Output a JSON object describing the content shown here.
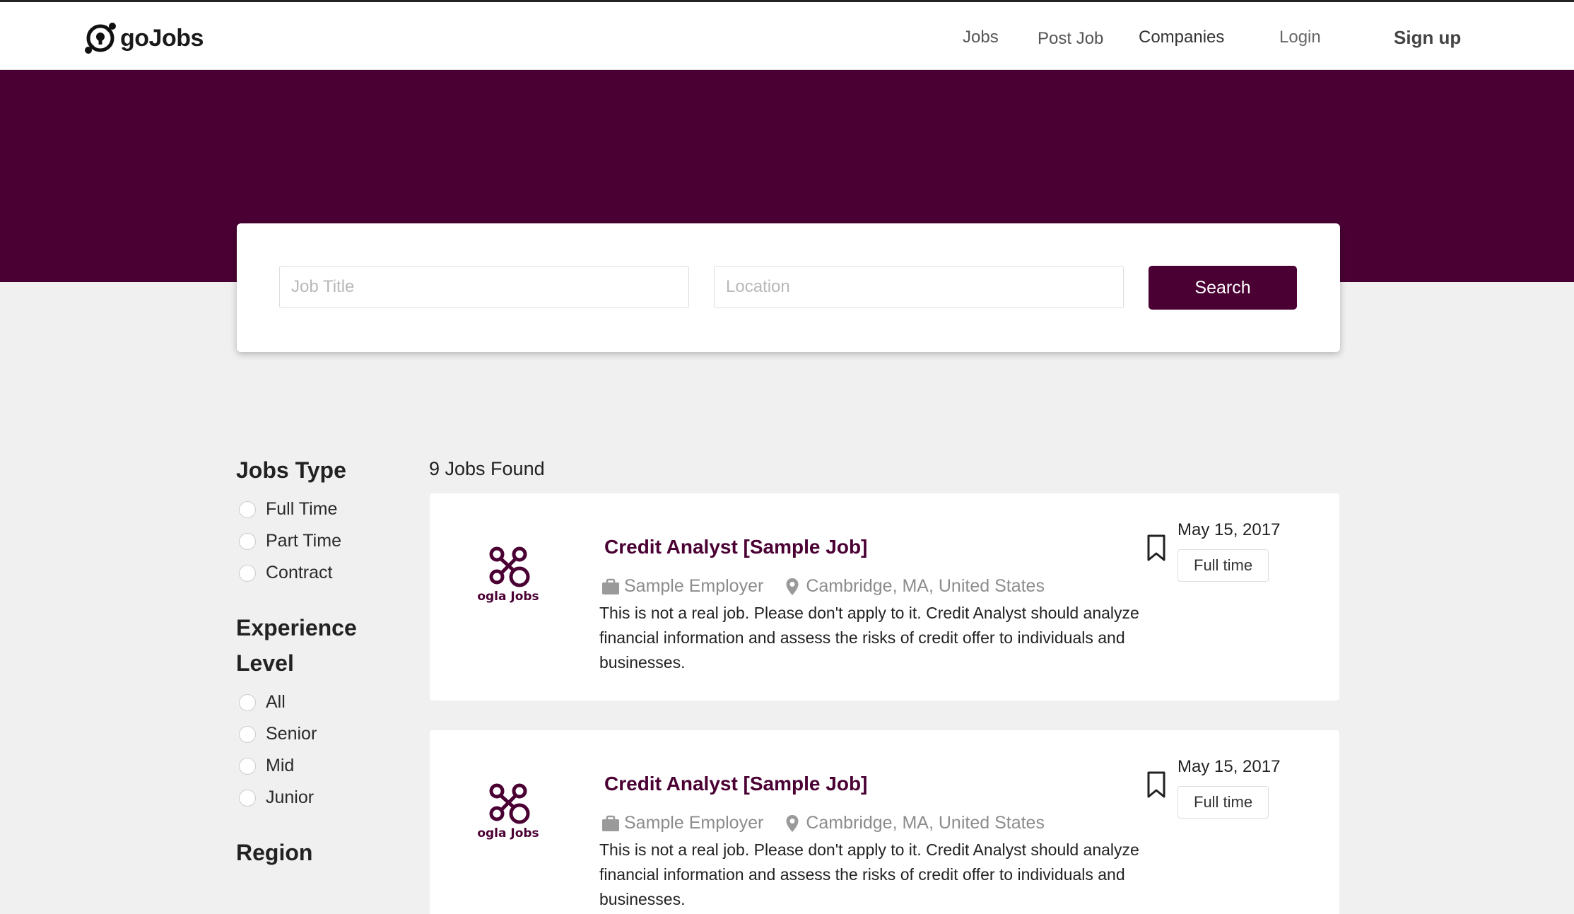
{
  "header": {
    "brand": "goJobs",
    "nav": {
      "jobs": "Jobs",
      "post_job": "Post Job",
      "companies": "Companies",
      "login": "Login",
      "sign_up": "Sign up"
    }
  },
  "colors": {
    "primary": "#4a0033",
    "page_bg": "#f0f0f0"
  },
  "search": {
    "job_title_placeholder": "Job Title",
    "location_placeholder": "Location",
    "button": "Search"
  },
  "filters": {
    "jobs_type": {
      "heading": "Jobs Type",
      "options": [
        "Full Time",
        "Part Time",
        "Contract"
      ]
    },
    "experience": {
      "heading": "Experience Level",
      "options": [
        "All",
        "Senior",
        "Mid",
        "Junior"
      ]
    },
    "region": {
      "heading": "Region"
    }
  },
  "results": {
    "count_text": "9 Jobs Found",
    "jobs": [
      {
        "logo_text": "ogla Jobs",
        "title": "Credit Analyst [Sample Job]",
        "employer": "Sample Employer",
        "location": "Cambridge, MA, United States",
        "description": "This is not a real job. Please don't apply to it. Credit Analyst should analyze financial information and assess the risks of credit offer to individuals and businesses.",
        "date": "May 15, 2017",
        "type": "Full time"
      },
      {
        "logo_text": "ogla Jobs",
        "title": "Credit Analyst [Sample Job]",
        "employer": "Sample Employer",
        "location": "Cambridge, MA, United States",
        "description": "This is not a real job. Please don't apply to it. Credit Analyst should analyze financial information and assess the risks of credit offer to individuals and businesses.",
        "date": "May 15, 2017",
        "type": "Full time"
      }
    ]
  }
}
